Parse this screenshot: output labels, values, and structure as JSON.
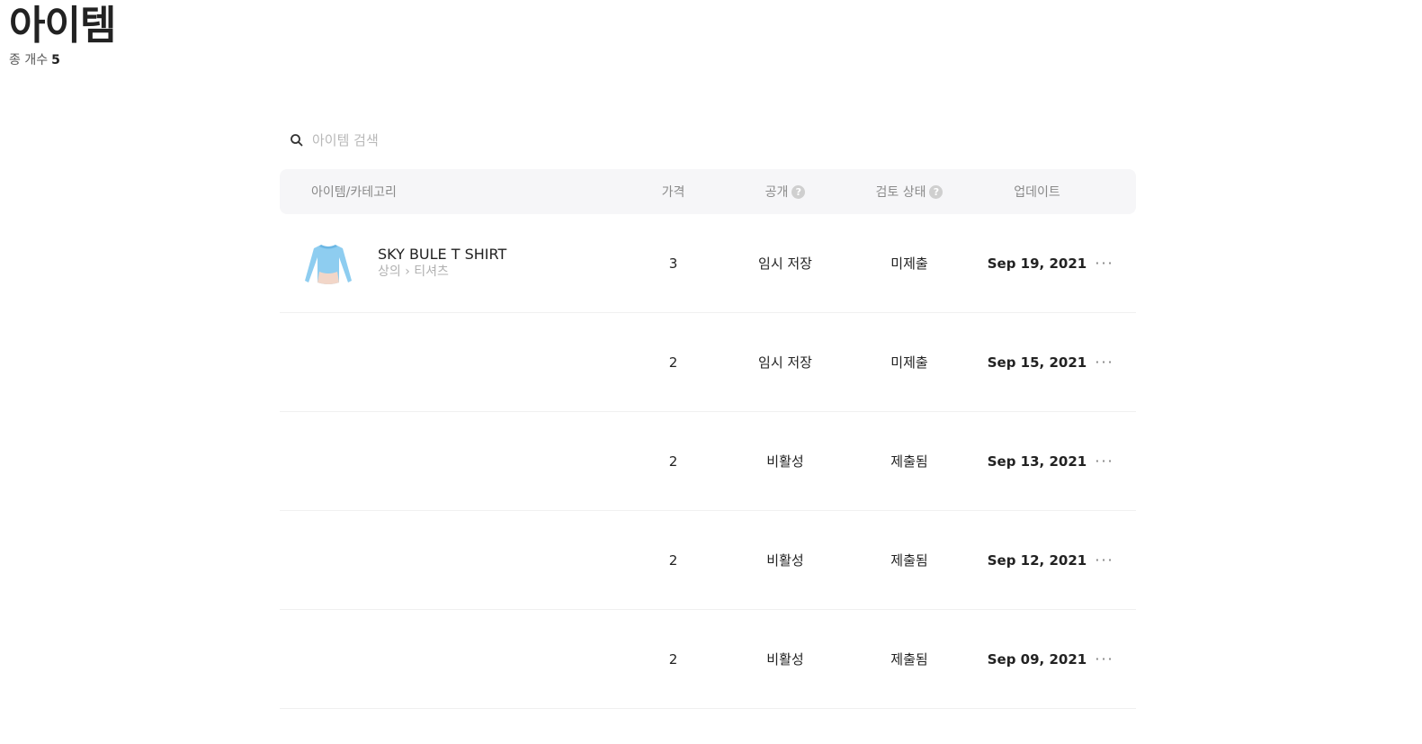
{
  "header": {
    "title": "아이템",
    "total_label": "종 개수",
    "total_count": "5"
  },
  "search": {
    "placeholder": "아이템 검색",
    "value": ""
  },
  "table": {
    "columns": {
      "item": "아이템/카테고리",
      "price": "가격",
      "public": "공개",
      "review": "검토 상태",
      "update": "업데이트"
    },
    "rows": [
      {
        "name": "SKY BULE T SHIRT",
        "category": "상의 › 티셔츠",
        "price": "3",
        "public": "임시 저장",
        "review": "미제출",
        "updated": "Sep 19, 2021",
        "more": "···"
      },
      {
        "name": "",
        "category": "",
        "price": "2",
        "public": "임시 저장",
        "review": "미제출",
        "updated": "Sep 15, 2021",
        "more": "···"
      },
      {
        "name": "",
        "category": "",
        "price": "2",
        "public": "비활성",
        "review": "제출됨",
        "updated": "Sep 13, 2021",
        "more": "···"
      },
      {
        "name": "",
        "category": "",
        "price": "2",
        "public": "비활성",
        "review": "제출됨",
        "updated": "Sep 12, 2021",
        "more": "···"
      },
      {
        "name": "",
        "category": "",
        "price": "2",
        "public": "비활성",
        "review": "제출됨",
        "updated": "Sep 09, 2021",
        "more": "···"
      }
    ]
  },
  "colors": {
    "header_bg": "#f6f6f8",
    "shirt_blue": "#8ecdf0",
    "muted": "#b0b0b0"
  },
  "icons": {
    "search": "search-icon",
    "help": "help-icon",
    "more": "more-icon",
    "thumbnail": "tshirt-thumbnail"
  }
}
